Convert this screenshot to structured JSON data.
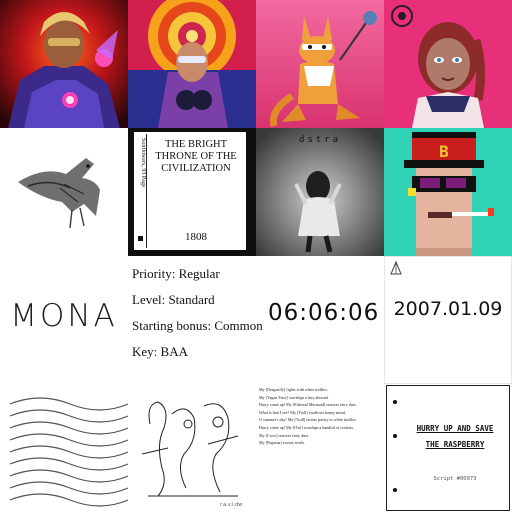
{
  "gallery": {
    "tile_book": {
      "title": "THE BRIGHT THRONE OF THE CIVILIZATION",
      "title_line1": "THE BRIGHT",
      "title_line2": "THRONE OF THE",
      "title_line3": "CIVILIZATION",
      "spine_text": "Sunflowers, 93 Page",
      "number": "1808"
    },
    "tile_dstra": {
      "label": "dstra"
    },
    "tile_punk": {
      "glyph": "B"
    },
    "tile_mona": {
      "logo": "MONA"
    },
    "tile_traits": {
      "priority": "Priority: Regular",
      "level": "Level: Standard",
      "bonus": "Starting bonus: Common",
      "key": "Key: BAA"
    },
    "tile_clock": {
      "time": "06:06:06"
    },
    "tile_date": {
      "date": "2007.01.09"
    },
    "tile_doodle": {
      "signature": "r.a.v.l.dw"
    },
    "tile_poem": {
      "lines": [
        "My [Dragonfly] fights with white truffles.",
        "My [Vegan Fairy] worships a tiny almond.",
        "Hurry come up! My [Ethereal Mermaid] restores fairy dust.",
        "What is that I see? My [Troll] swallows honey mead.",
        "O summer's day! My [Troll] recites poetry to white truffles.",
        "Hurry come up! My [Owl] worships a handful of crickets.",
        "My [Crow] restores fairy dust.",
        "My [Pegasus] swears twirls."
      ]
    },
    "tile_script": {
      "line1": "HURRY UP AND SAVE",
      "line2": "THE RASPBERRY",
      "footer": "Script #00073"
    }
  },
  "colors": {
    "book_bg": "#0f0f0f",
    "punk_bg": "#2fd2b4",
    "pink_bg": "#e8307a",
    "mona_ink": "#1c1c1c"
  }
}
